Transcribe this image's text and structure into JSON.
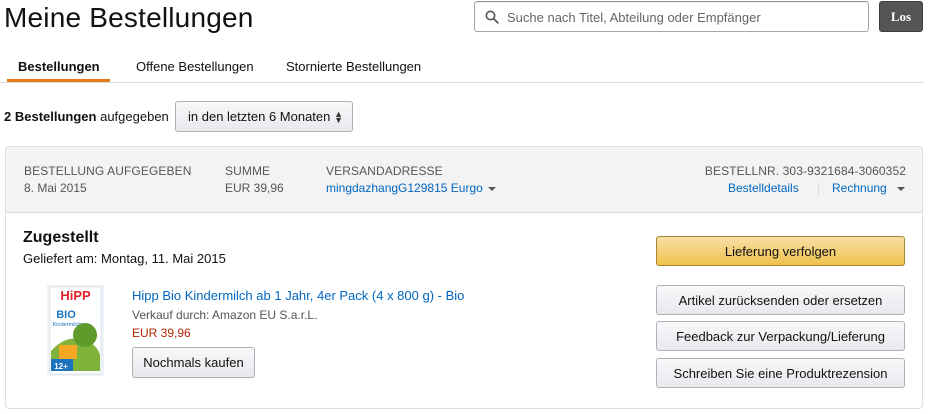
{
  "header": {
    "title": "Meine Bestellungen",
    "search_placeholder": "Suche nach Titel, Abteilung oder Empfänger",
    "search_value": "",
    "go_label": "Los"
  },
  "tabs": [
    {
      "label": "Bestellungen",
      "active": true
    },
    {
      "label": "Offene Bestellungen",
      "active": false
    },
    {
      "label": "Stornierte Bestellungen",
      "active": false
    }
  ],
  "summary": {
    "count_text": "2 Bestellungen",
    "suffix": "aufgegeben",
    "range_selected": "in den letzten 6 Monaten"
  },
  "order": {
    "placed_label": "BESTELLUNG AUFGEGEBEN",
    "placed_value": "8. Mai 2015",
    "total_label": "SUMME",
    "total_value": "EUR 39,96",
    "ship_label": "VERSANDADRESSE",
    "ship_value": "mingdazhangG129815 Eurgo",
    "order_no": "BESTELLNR. 303-9321684-3060352",
    "details_link": "Bestelldetails",
    "invoice_link": "Rechnung",
    "status": "Zugestellt",
    "delivered": "Geliefert am: Montag, 11. Mai 2015",
    "track_button": "Lieferung verfolgen",
    "actions": [
      "Artikel zurücksenden oder ersetzen",
      "Feedback zur Verpackung/Lieferung",
      "Schreiben Sie eine Produktrezension"
    ],
    "item": {
      "title": "Hipp Bio Kindermilch ab 1 Jahr, 4er Pack (4 x 800 g) - Bio",
      "seller": "Verkauf durch: Amazon EU S.a.r.L.",
      "price": "EUR 39,96",
      "buy_again": "Nochmals kaufen",
      "logo_text": "HiPP",
      "bio_text": "BIO",
      "kinder_text": "Kindermilch",
      "age_text": "12+"
    }
  },
  "colors": {
    "accent": "#e47911",
    "link": "#0066c0",
    "price": "#b12704",
    "primary_button": "#f0c14b"
  }
}
